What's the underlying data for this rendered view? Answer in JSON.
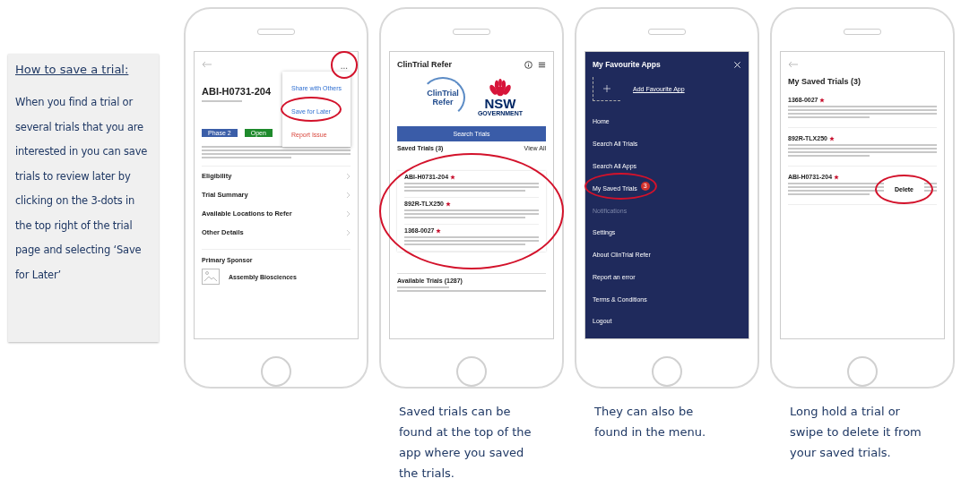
{
  "instructions": {
    "heading": "How to save a trial:",
    "body": "When you find a trial or several trials that you are interested in you can save trials to review later by clicking on the 3-dots in the top right of the trial page and selecting ‘Save for Later’"
  },
  "phones": [
    {
      "kind": "detail",
      "more_button": "...",
      "more_circled": true,
      "trial_id": "ABI-H0731-204",
      "menu": [
        {
          "label": "Share with Others",
          "kind": "action",
          "circled": false
        },
        {
          "label": "Save for Later",
          "kind": "action",
          "circled": true
        },
        {
          "label": "Report Issue",
          "kind": "danger",
          "circled": false
        }
      ],
      "tags": [
        {
          "label": "Phase 2",
          "color": "#3b5ea8"
        },
        {
          "label": "Open",
          "color": "#1e8a2c"
        }
      ],
      "sections": [
        {
          "label": "Eligibility"
        },
        {
          "label": "Trial Summary"
        },
        {
          "label": "Available Locations to Refer"
        },
        {
          "label": "Other Details"
        }
      ],
      "sponsor_label": "Primary Sponsor",
      "sponsor": "Assembly Biosciences"
    },
    {
      "kind": "home",
      "title": "ClinTrial Refer",
      "logo_lines": [
        "ClinTrial",
        "Refer"
      ],
      "gov_logo": [
        "NSW",
        "GOVERNMENT"
      ],
      "search_button": "Search Trials",
      "saved_heading": "Saved Trials (3)",
      "view_all": "View All",
      "saved_circled": true,
      "trials": [
        {
          "id": "ABI-H0731-204"
        },
        {
          "id": "892R-TLX250"
        },
        {
          "id": "1368-0027"
        }
      ],
      "available_heading": "Available Trials (1287)",
      "caption": "Saved trials can be found at the top of the app where you saved the trials."
    },
    {
      "kind": "menu",
      "title": "My Favourite Apps",
      "add_link": "Add Favourite App",
      "items": [
        {
          "label": "Home",
          "disabled": false,
          "circled": false
        },
        {
          "label": "Search All Trials",
          "disabled": false,
          "circled": false
        },
        {
          "label": "Search All Apps",
          "disabled": false,
          "circled": false
        },
        {
          "label": "My Saved Trials",
          "badge": "3",
          "disabled": false,
          "circled": true
        },
        {
          "label": "Notifications",
          "disabled": true,
          "circled": false
        },
        {
          "label": "Settings",
          "disabled": false,
          "circled": false
        },
        {
          "label": "About ClinTrial Refer",
          "disabled": false,
          "circled": false
        },
        {
          "label": "Report an error",
          "disabled": false,
          "circled": false
        },
        {
          "label": "Terms & Conditions",
          "disabled": false,
          "circled": false
        },
        {
          "label": "Logout",
          "disabled": false,
          "circled": false
        }
      ],
      "caption": "They can also be found in the menu."
    },
    {
      "kind": "saved",
      "title": "My Saved Trials (3)",
      "trials": [
        {
          "id": "1368-0027"
        },
        {
          "id": "892R-TLX250"
        },
        {
          "id": "ABI-H0731-204",
          "popup": "Delete"
        }
      ],
      "caption": "Long hold a trial or swipe to delete it from your saved trials."
    }
  ]
}
